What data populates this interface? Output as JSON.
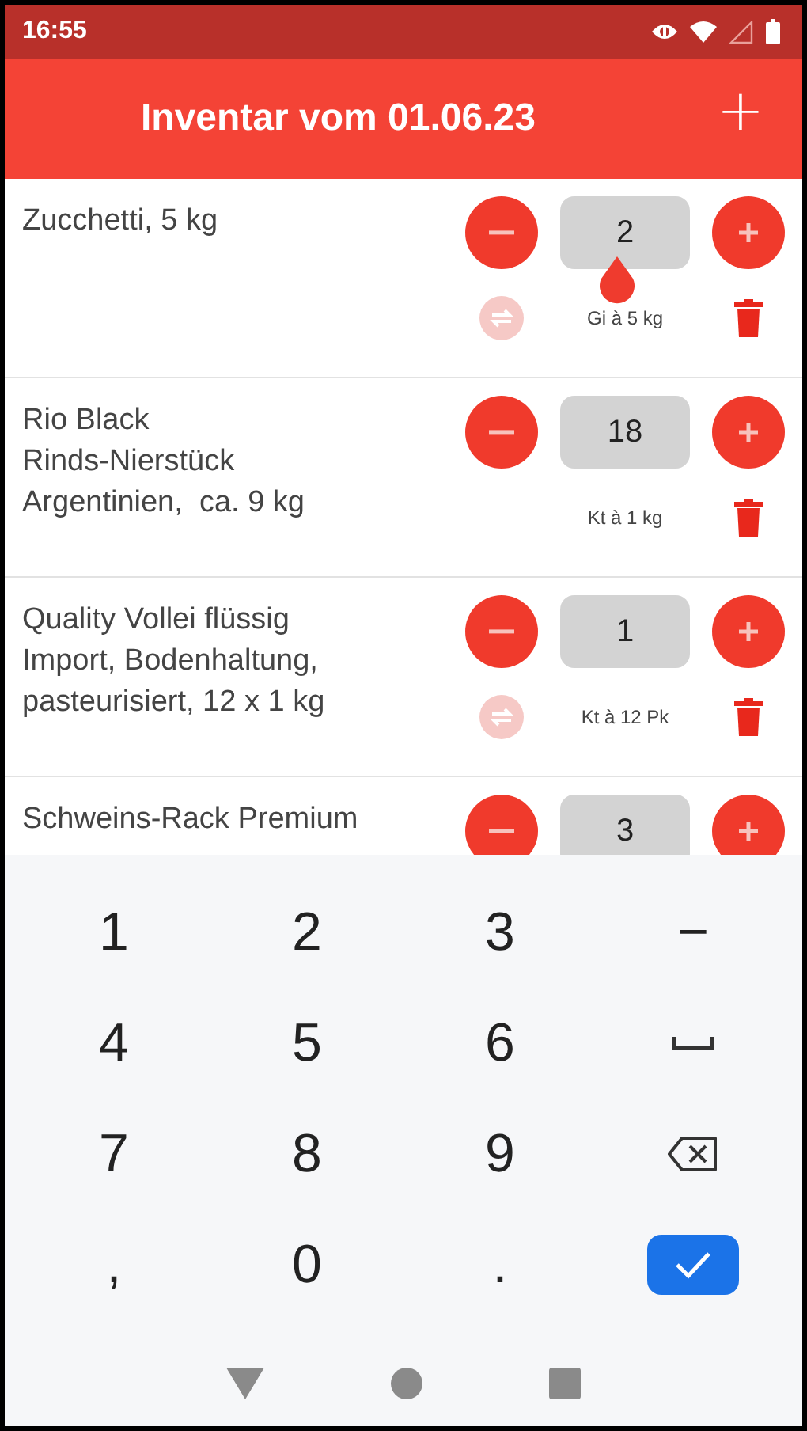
{
  "status_bar": {
    "time": "16:55"
  },
  "app_bar": {
    "title": "Inventar vom 01.06.23",
    "add_symbol": "+"
  },
  "items": [
    {
      "name": "Zucchetti, 5 kg",
      "quantity": "2",
      "unit": "Gi à 5 kg",
      "swap": true,
      "focused": true
    },
    {
      "name": "Rio Black\nRinds-Nierstück\nArgentinien,  ca. 9 kg",
      "quantity": "18",
      "unit": "Kt à 1 kg",
      "swap": false,
      "focused": false
    },
    {
      "name": "Quality Vollei flüssig\nImport, Bodenhaltung,\npasteurisiert, 12 x 1 kg",
      "quantity": "1",
      "unit": "Kt à 12 Pk",
      "swap": true,
      "focused": false
    },
    {
      "name": "Schweins-Rack Premium",
      "quantity": "3",
      "swap": false,
      "focused": false
    }
  ],
  "keyboard": {
    "keys": [
      {
        "kind": "text",
        "label": "1"
      },
      {
        "kind": "text",
        "label": "2"
      },
      {
        "kind": "text",
        "label": "3"
      },
      {
        "kind": "text",
        "label": "−"
      },
      {
        "kind": "text",
        "label": "4"
      },
      {
        "kind": "text",
        "label": "5"
      },
      {
        "kind": "text",
        "label": "6"
      },
      {
        "kind": "space"
      },
      {
        "kind": "text",
        "label": "7"
      },
      {
        "kind": "text",
        "label": "8"
      },
      {
        "kind": "text",
        "label": "9"
      },
      {
        "kind": "backspace"
      },
      {
        "kind": "text",
        "label": ","
      },
      {
        "kind": "text",
        "label": "0"
      },
      {
        "kind": "text",
        "label": "."
      },
      {
        "kind": "done"
      }
    ]
  }
}
